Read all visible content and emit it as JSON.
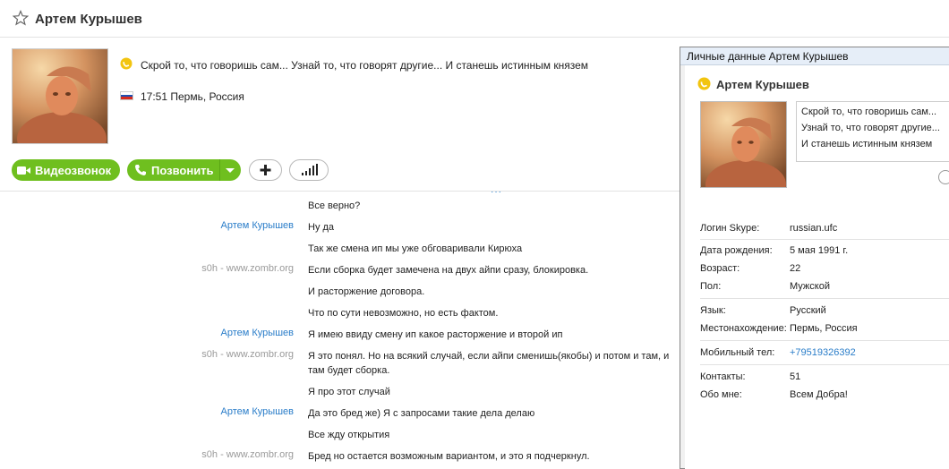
{
  "header": {
    "title": "Артем Курышев"
  },
  "profile": {
    "mood": "Скрой то, что говоришь сам... Узнай то, что говорят другие... И станешь истинным князем",
    "local_info": "17:51 Пермь, Россия"
  },
  "actions": {
    "video_call": "Видеозвонок",
    "call": "Позвонить"
  },
  "chat": [
    {
      "sender": "",
      "text": "Все верно?",
      "color": "#2a7dc9"
    },
    {
      "sender": "Артем Курышев",
      "text": "Ну да",
      "color": "#2a7dc9"
    },
    {
      "sender": "",
      "text": "Так же смена ип мы уже обговаривали Кирюха",
      "color": "#9a9a9a"
    },
    {
      "sender": "s0h - www.zombr.org",
      "text": "Если сборка будет замечена на двух айпи сразу, блокировка.",
      "color": "#9a9a9a"
    },
    {
      "sender": "",
      "text": "И расторжение договора.",
      "color": "#9a9a9a"
    },
    {
      "sender": "",
      "text": "Что по сути невозможно, но есть фактом.",
      "color": "#9a9a9a"
    },
    {
      "sender": "Артем Курышев",
      "text": "Я имею ввиду смену ип какое расторжение и второй ип",
      "color": "#2a7dc9"
    },
    {
      "sender": "s0h - www.zombr.org",
      "text": "Я это понял. Но на всякий случай, если айпи сменишь(якобы) и потом и там, и там будет сборка.",
      "color": "#9a9a9a"
    },
    {
      "sender": "",
      "text": "Я про этот случай",
      "color": "#9a9a9a"
    },
    {
      "sender": "Артем Курышев",
      "text": "Да это бред же) Я с запросами такие дела делаю",
      "color": "#2a7dc9"
    },
    {
      "sender": "",
      "text": "Все жду открытия",
      "color": "#2a7dc9"
    },
    {
      "sender": "s0h - www.zombr.org",
      "text": "Бред но остается возможным вариантом, и это я подчеркнул.",
      "color": "#9a9a9a"
    }
  ],
  "personal_window": {
    "title": "Личные данные Артем Курышев",
    "name": "Артем Курышев",
    "mood": "Скрой то, что говоришь сам... Узнай то, что говорят другие... И станешь истинным князем",
    "fields": {
      "skype_login": {
        "label": "Логин Skype:",
        "value": "russian.ufc"
      },
      "birthday": {
        "label": "Дата рождения:",
        "value": "5 мая 1991 г."
      },
      "age": {
        "label": "Возраст:",
        "value": "22"
      },
      "gender": {
        "label": "Пол:",
        "value": "Мужской"
      },
      "language": {
        "label": "Язык:",
        "value": "Русский"
      },
      "location": {
        "label": "Местонахождение:",
        "value": "Пермь, Россия"
      },
      "mobile": {
        "label": "Мобильный тел:",
        "value": "+79519326392"
      },
      "contacts": {
        "label": "Контакты:",
        "value": "51"
      },
      "about": {
        "label": "Обо мне:",
        "value": "Всем Добра!"
      }
    }
  },
  "colors": {
    "accent_green": "#6fbf1f",
    "link_blue": "#2a7dc9",
    "skype_yellow": "#f2c40f"
  }
}
